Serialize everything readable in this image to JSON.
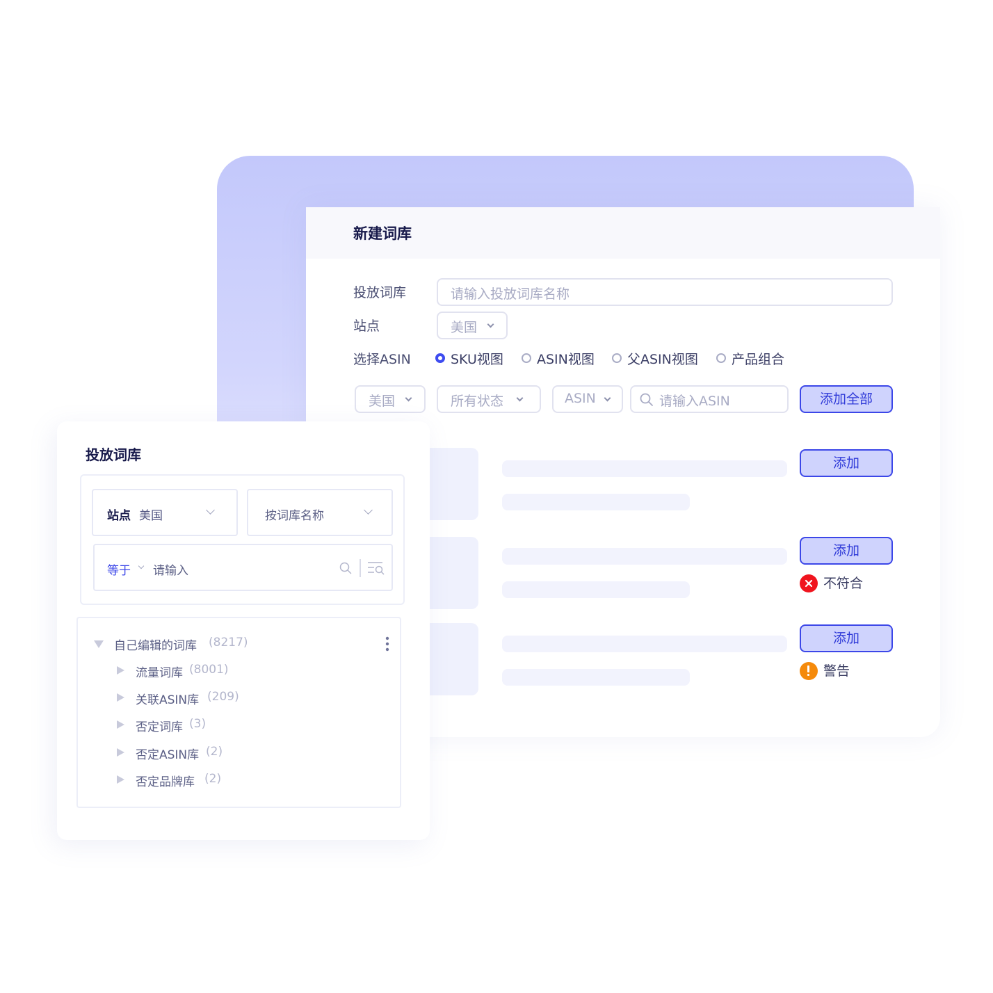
{
  "dialog": {
    "title": "新建词库",
    "form": {
      "library_label": "投放词库",
      "library_placeholder": "请输入投放词库名称",
      "site_label": "站点",
      "site_value": "美国",
      "asin_label": "选择ASIN",
      "view_options": [
        {
          "label": "SKU视图",
          "selected": true
        },
        {
          "label": "ASIN视图",
          "selected": false
        },
        {
          "label": "父ASIN视图",
          "selected": false
        },
        {
          "label": "产品组合",
          "selected": false
        }
      ]
    },
    "filters": {
      "country": "美国",
      "status": "所有状态",
      "type": "ASIN",
      "search_placeholder": "请输入ASIN",
      "add_all_label": "添加全部"
    },
    "rows": [
      {
        "add_label": "添加",
        "status": ""
      },
      {
        "add_label": "添加",
        "status": "不符合",
        "status_kind": "error"
      },
      {
        "add_label": "添加",
        "status": "警告",
        "status_kind": "warning"
      }
    ],
    "colors": {
      "accent": "#3c47e8",
      "error": "#f0141e",
      "warning": "#f58a0b"
    }
  },
  "panel": {
    "title": "投放词库",
    "site_label": "站点",
    "site_value": "美国",
    "sort_label": "按词库名称",
    "operator": "等于",
    "search_placeholder": "请输入",
    "tree": {
      "root": {
        "label": "自己编辑的词库",
        "count": "(8217)"
      },
      "children": [
        {
          "label": "流量词库",
          "count": "(8001)"
        },
        {
          "label": "关联ASIN库",
          "count": "(209)"
        },
        {
          "label": "否定词库",
          "count": "(3)"
        },
        {
          "label": "否定ASIN库",
          "count": "(2)"
        },
        {
          "label": "否定品牌库",
          "count": "(2)"
        }
      ]
    }
  }
}
